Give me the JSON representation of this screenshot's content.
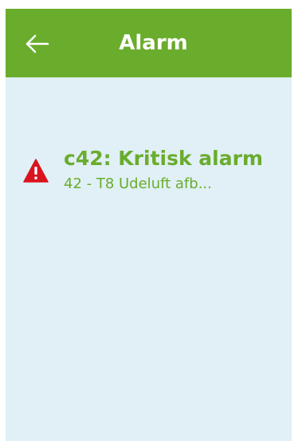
{
  "header": {
    "title": "Alarm",
    "back_icon": "arrow-left-icon",
    "background_color": "#6aac2c"
  },
  "alarm": {
    "title": "c42: Kritisk alarm",
    "description": "42 - T8 Udeluft afb...",
    "icon": "warning-triangle-icon",
    "icon_color": "#d9141e",
    "text_color": "#6aac2c"
  },
  "screen": {
    "background_color": "#e0f0f6"
  }
}
